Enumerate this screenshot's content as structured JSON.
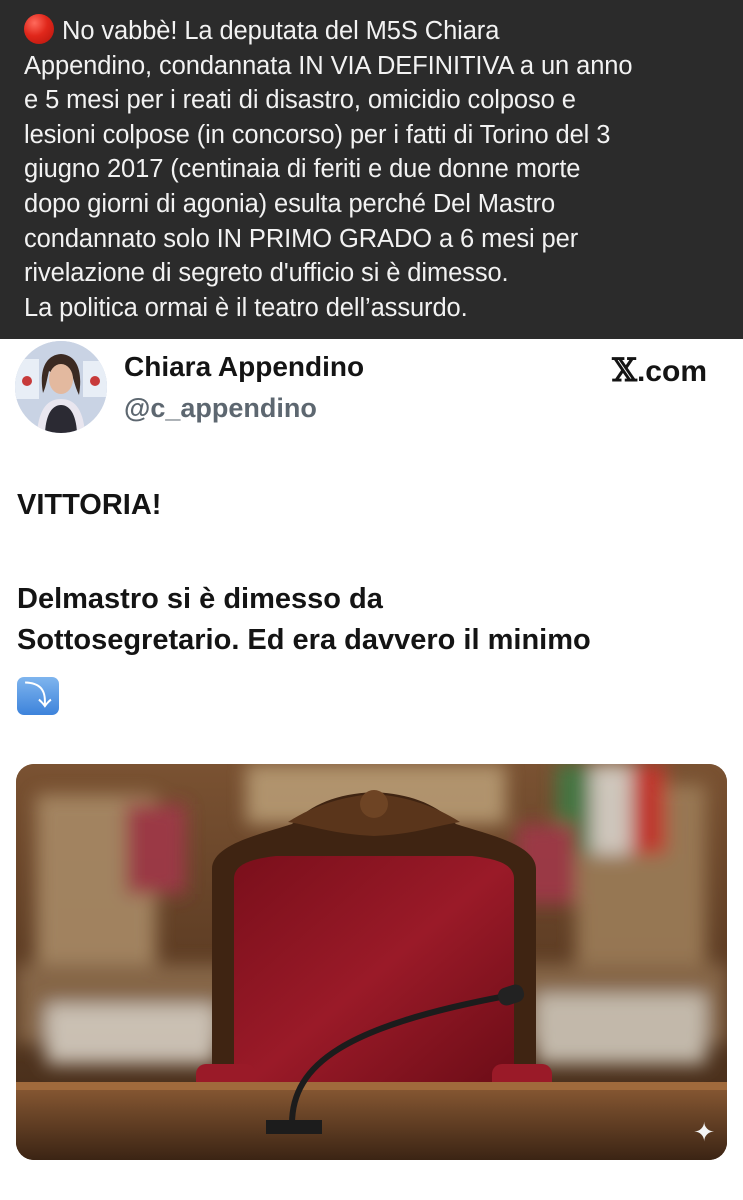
{
  "caption": {
    "indicator_icon": "red-circle-icon",
    "text": "No vabbè! La deputata del M5S Chiara\nAppendino, condannata IN VIA DEFINITIVA a un anno\ne 5 mesi per i reati di disastro, omicidio colposo e\nlesioni colpose (in concorso) per i fatti di Torino del 3\ngiugno 2017 (centinaia di feriti e due donne morte\ndopo giorni di agonia) esulta perché Del Mastro\ncondannato solo IN PRIMO GRADO a 6 mesi per\nrivelazione di segreto d'ufficio si è dimesso.\nLa politica ormai è il teatro dell’assurdo."
  },
  "tweet": {
    "author_name": "Chiara Appendino",
    "author_handle": "@c_appendino",
    "source_x": "𝕏",
    "source_domain": ".com",
    "headline": "VITTORIA!",
    "body": "Delmastro si è dimesso da\nSottosegretario. Ed era davvero il minimo",
    "emoji": "⤵",
    "emoji_icon": "right-arrow-curving-down-icon",
    "media_icon": "red-velvet-chair-photo",
    "sparkle": "✦"
  },
  "colors": {
    "caption_bg": "#2b2b2b",
    "caption_text": "#f2f2f2",
    "name_text": "#141414",
    "handle_text": "#5d6770",
    "chair_red": "#8a1420"
  }
}
